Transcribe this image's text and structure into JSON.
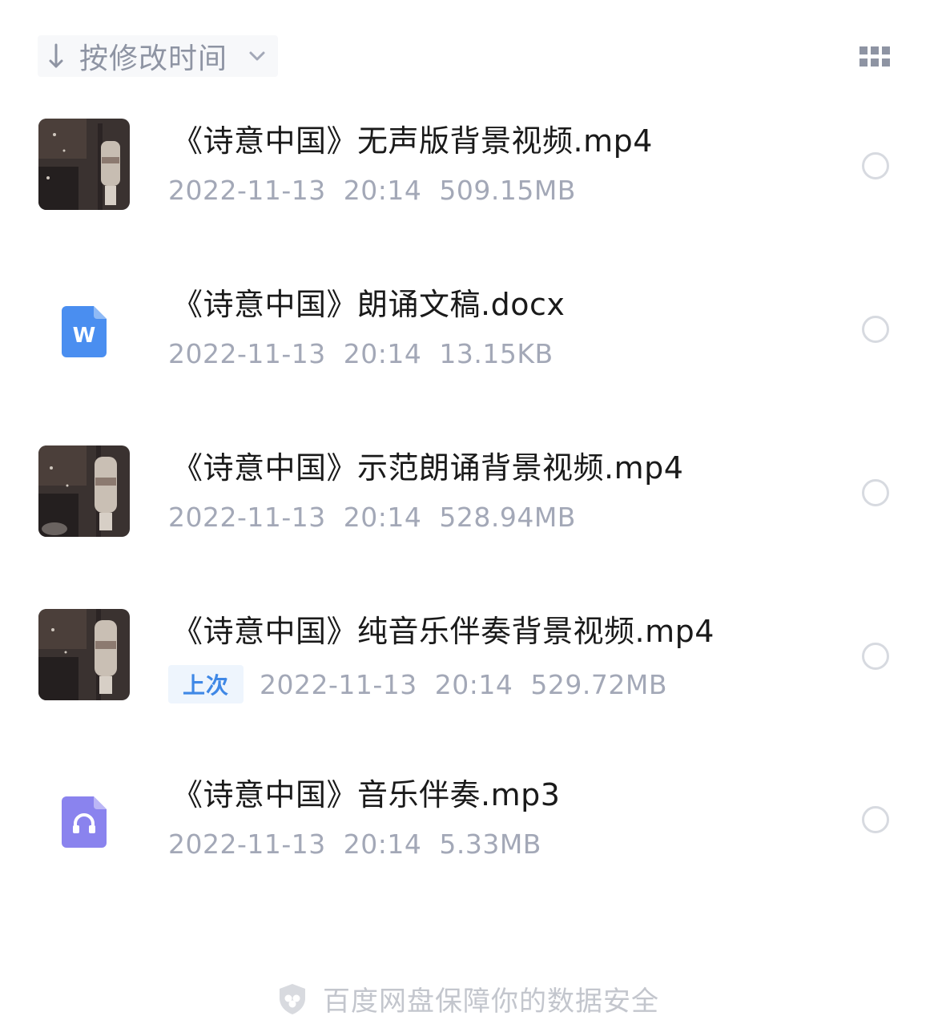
{
  "sort": {
    "label": "按修改时间",
    "direction_icon": "arrow-down-icon",
    "dropdown_icon": "chevron-down-icon"
  },
  "view_toggle": {
    "icon": "grid-view-icon"
  },
  "files": [
    {
      "name": "《诗意中国》无声版背景视频.mp4",
      "date": "2022-11-13",
      "time": "20:14",
      "size": "509.15MB",
      "type": "video",
      "badge": ""
    },
    {
      "name": "《诗意中国》朗诵文稿.docx",
      "date": "2022-11-13",
      "time": "20:14",
      "size": "13.15KB",
      "type": "word",
      "icon_letter": "W",
      "badge": ""
    },
    {
      "name": "《诗意中国》示范朗诵背景视频.mp4",
      "date": "2022-11-13",
      "time": "20:14",
      "size": "528.94MB",
      "type": "video",
      "badge": ""
    },
    {
      "name": "《诗意中国》纯音乐伴奏背景视频.mp4",
      "date": "2022-11-13",
      "time": "20:14",
      "size": "529.72MB",
      "type": "video",
      "badge": "上次"
    },
    {
      "name": "《诗意中国》音乐伴奏.mp3",
      "date": "2022-11-13",
      "time": "20:14",
      "size": "5.33MB",
      "type": "audio",
      "badge": ""
    }
  ],
  "footer": {
    "text": "百度网盘保障你的数据安全",
    "icon": "shield-icon"
  },
  "colors": {
    "word_icon": "#4a8ef0",
    "audio_icon": "#8a83ee",
    "badge_text": "#3f88e6",
    "meta_text": "#a3a8b7"
  }
}
